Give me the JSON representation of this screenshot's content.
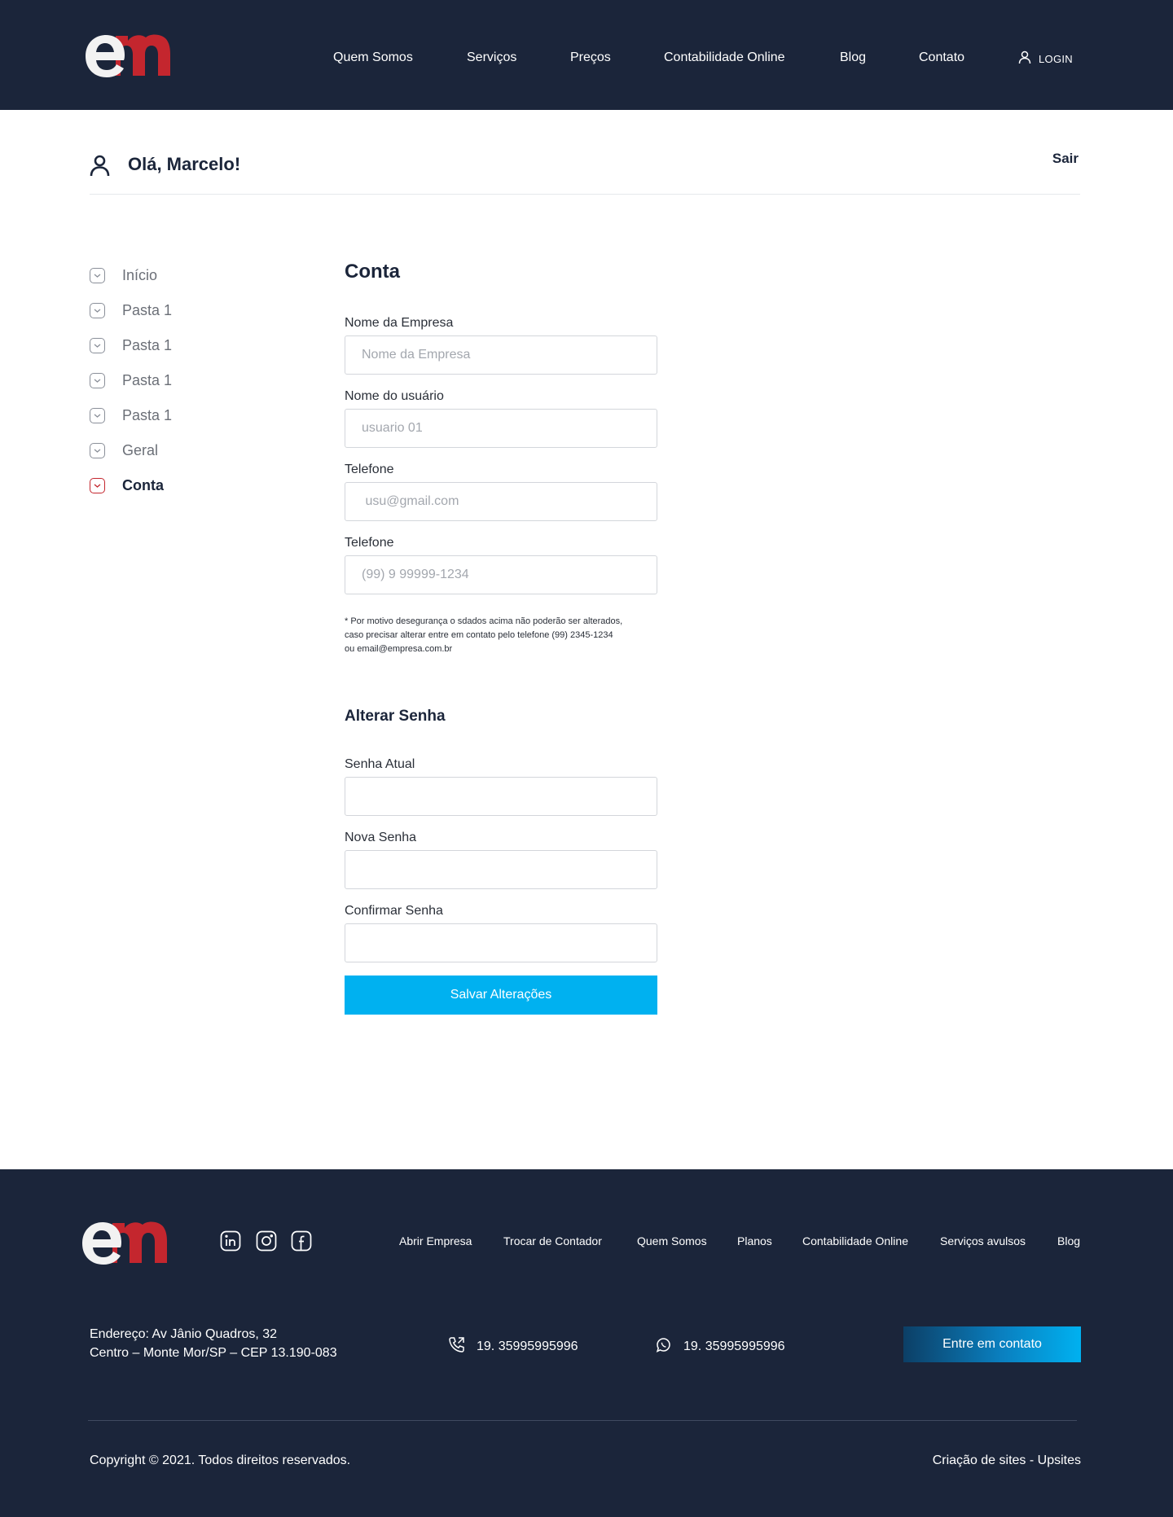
{
  "header": {
    "nav": [
      "Quem Somos",
      "Serviços",
      "Preços",
      "Contabilidade Online",
      "Blog",
      "Contato"
    ],
    "login": "LOGIN"
  },
  "userbar": {
    "greeting": "Olá, Marcelo!",
    "logout": "Sair"
  },
  "sidebar": {
    "items": [
      {
        "label": "Início",
        "active": false
      },
      {
        "label": "Pasta 1",
        "active": false
      },
      {
        "label": "Pasta 1",
        "active": false
      },
      {
        "label": "Pasta 1",
        "active": false
      },
      {
        "label": "Pasta 1",
        "active": false
      },
      {
        "label": "Geral",
        "active": false
      },
      {
        "label": "Conta",
        "active": true
      }
    ]
  },
  "account": {
    "title": "Conta",
    "fields": [
      {
        "label": "Nome da Empresa",
        "placeholder": "Nome da Empresa"
      },
      {
        "label": "Nome do usuário",
        "placeholder": "usuario 01"
      },
      {
        "label": "Telefone",
        "placeholder": " usu@gmail.com"
      },
      {
        "label": "Telefone",
        "placeholder": "(99) 9 99999-1234"
      }
    ],
    "note_lines": [
      "* Por motivo desegurança o sdados acima não poderão ser alterados,",
      "caso precisar alterar entre em contato pelo telefone (99) 2345-1234",
      "ou email@empresa.com.br"
    ]
  },
  "password": {
    "title": "Alterar Senha",
    "fields": [
      {
        "label": "Senha Atual"
      },
      {
        "label": "Nova Senha"
      },
      {
        "label": "Confirmar Senha"
      }
    ],
    "save_label": "Salvar Alterações"
  },
  "footer": {
    "nav": [
      "Abrir Empresa",
      "Trocar de Contador",
      "Quem Somos",
      "Planos",
      "Contabilidade Online",
      "Serviços avulsos",
      "Blog"
    ],
    "address_lines": [
      "Endereço: Av Jânio Quadros, 32",
      "Centro – Monte Mor/SP – CEP 13.190-083"
    ],
    "phone": "19. 35995995996",
    "whatsapp": "19. 35995995996",
    "contact_button": "Entre em contato",
    "copyright": "Copyright © 2021. Todos direitos reservados.",
    "credit": "Criação de sites - Upsites",
    "social_icons": [
      "linkedin-icon",
      "instagram-icon",
      "facebook-icon"
    ]
  },
  "colors": {
    "navy": "#1b253a",
    "brand_red": "#c4262e",
    "accent_blue": "#00b1f0"
  }
}
